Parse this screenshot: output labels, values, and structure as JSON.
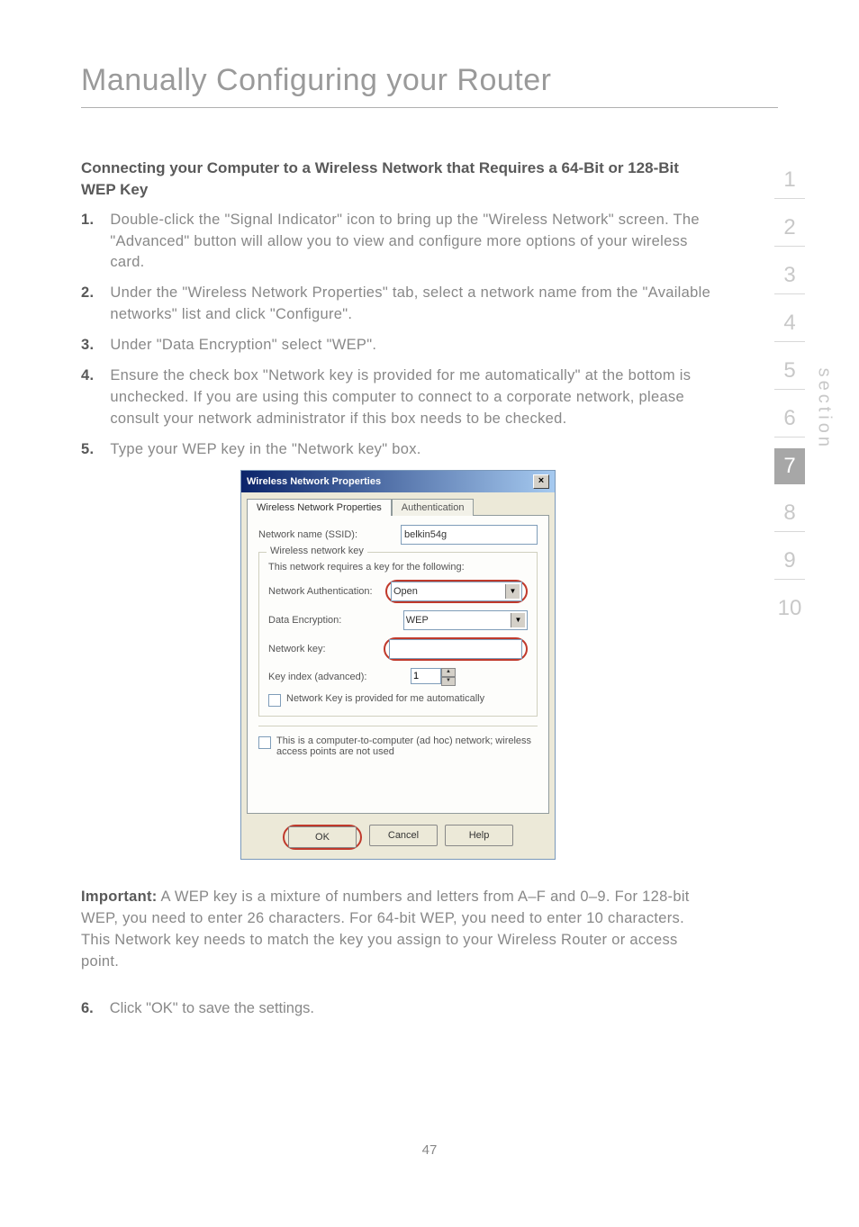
{
  "page_title": "Manually Configuring your Router",
  "subheading": "Connecting your Computer to a Wireless Network that Requires a 64-Bit or 128-Bit WEP Key",
  "steps": [
    {
      "n": "1.",
      "t": "Double-click the \"Signal Indicator\" icon to bring up the \"Wireless Network\" screen. The \"Advanced\" button will allow you to view and configure more options of your wireless card."
    },
    {
      "n": "2.",
      "t": "Under the \"Wireless Network Properties\" tab, select a network name from the \"Available networks\" list and click \"Configure\"."
    },
    {
      "n": "3.",
      "t": "Under \"Data Encryption\" select \"WEP\"."
    },
    {
      "n": "4.",
      "t": "Ensure the check box \"Network key is provided for me automatically\" at the bottom is unchecked. If you are using this computer to connect to a corporate network, please consult your network administrator if this box needs to be checked."
    },
    {
      "n": "5.",
      "t": "Type your WEP key in the \"Network key\" box."
    }
  ],
  "dialog": {
    "title": "Wireless Network Properties",
    "close_glyph": "×",
    "tab1": "Wireless Network Properties",
    "tab2": "Authentication",
    "ssid_label": "Network name (SSID):",
    "ssid_value": "belkin54g",
    "group1_title": "Wireless network key",
    "group1_note": "This network requires a key for the following:",
    "auth_label": "Network Authentication:",
    "auth_value": "Open",
    "enc_label": "Data Encryption:",
    "enc_value": "WEP",
    "key_label": "Network key:",
    "keyindex_label": "Key index (advanced):",
    "keyindex_value": "1",
    "auto_label": "Network Key is provided for me automatically",
    "adhoc_label": "This is a computer-to-computer (ad hoc) network; wireless access points are not used",
    "btn_ok": "OK",
    "btn_cancel": "Cancel",
    "btn_help": "Help"
  },
  "important_label": "Important:",
  "important_text": " A WEP key is a mixture of numbers and letters from A–F and 0–9. For 128-bit WEP, you need to enter 26 characters. For 64-bit WEP, you need to enter 10 characters. This Network key needs to match the key you assign to your Wireless Router or access point.",
  "final_step": {
    "n": "6.",
    "t": "Click \"OK\" to save the settings."
  },
  "section_label": "section",
  "sections": [
    "1",
    "2",
    "3",
    "4",
    "5",
    "6",
    "7",
    "8",
    "9",
    "10"
  ],
  "active_section_index": 6,
  "page_number": "47"
}
